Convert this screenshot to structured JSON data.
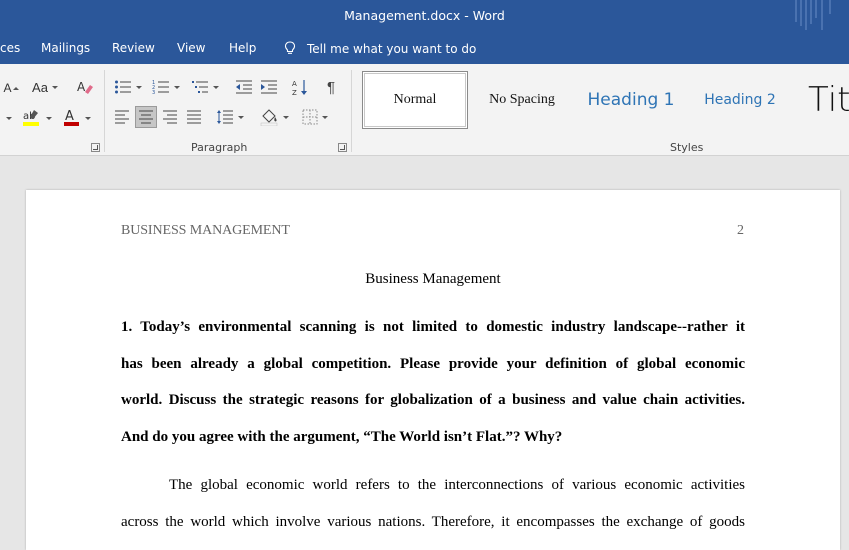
{
  "window": {
    "title": "Management.docx  -  Word"
  },
  "tabs": [
    {
      "label": "ces"
    },
    {
      "label": "Mailings"
    },
    {
      "label": "Review"
    },
    {
      "label": "View"
    },
    {
      "label": "Help"
    }
  ],
  "tell_me": "Tell me what you want to do",
  "ribbon": {
    "font_group": {
      "change_case_label": "Aa",
      "shrink_font_label": "A"
    },
    "paragraph_group": {
      "label": "Paragraph"
    },
    "styles_group": {
      "label": "Styles",
      "items": [
        {
          "label": "Normal"
        },
        {
          "label": "No Spacing"
        },
        {
          "label": "Heading 1"
        },
        {
          "label": "Heading 2"
        },
        {
          "label": "Titl"
        }
      ]
    },
    "colors": {
      "highlight": "#ffff00",
      "font_color": "#c00000",
      "accent": "#2b579a",
      "heading": "#2e74b5"
    }
  },
  "document": {
    "header_left": "BUSINESS MANAGEMENT",
    "page_number": "2",
    "title": "Business Management",
    "question_lines": [
      "1. Today’s environmental scanning is not limited to domestic industry landscape--rather it",
      "has been already a global competition. Please provide your definition of global economic",
      "world.  Discuss the strategic reasons for globalization of a business and value chain activities.",
      "And do you agree with the argument, “The World isn’t Flat.”? Why?"
    ],
    "body_lines": [
      "The global economic world refers to the interconnections of various economic activities",
      "across the world which involve various nations. Therefore, it encompasses the exchange of goods"
    ]
  }
}
